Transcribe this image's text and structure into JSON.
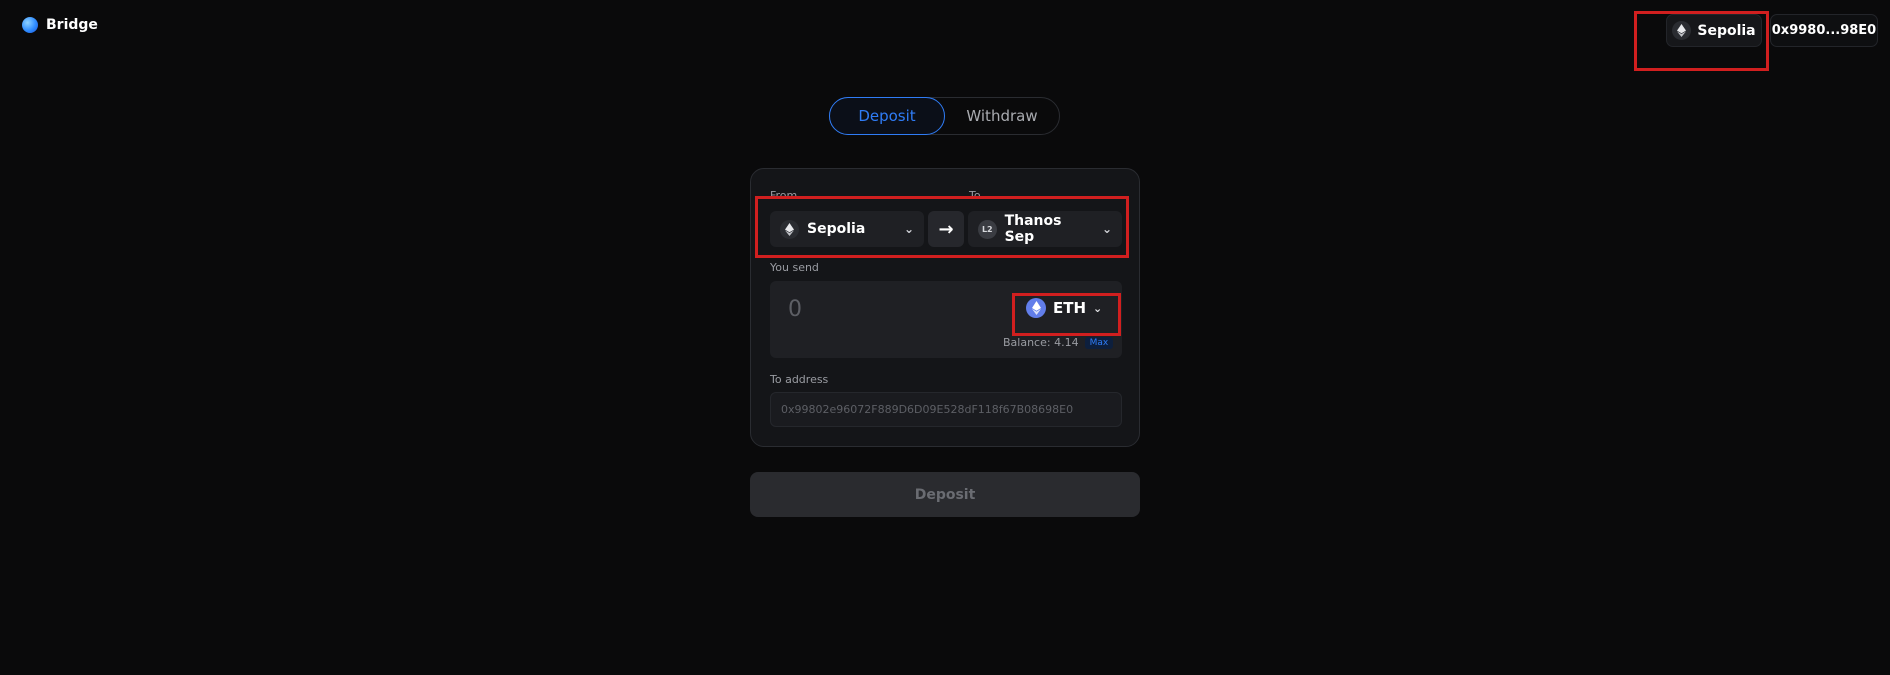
{
  "app": {
    "title": "Bridge"
  },
  "header": {
    "network_label": "Sepolia",
    "network_icon": "ethereum-icon",
    "wallet_label": "0x9980...98E0"
  },
  "tabs": [
    {
      "label": "Deposit",
      "active": true
    },
    {
      "label": "Withdraw",
      "active": false
    }
  ],
  "form": {
    "from_label": "From",
    "to_label": "To",
    "from_network": "Sepolia",
    "to_network": "Thanos Sep",
    "to_network_badge": "L2",
    "you_send_label": "You send",
    "amount_placeholder": "0",
    "token": "ETH",
    "balance_text": "Balance: 4.14",
    "max_label": "Max",
    "to_address_label": "To address",
    "to_address_placeholder": "0x99802e96072F889D6D09E528dF118f67B08698E0"
  },
  "submit": {
    "label": "Deposit"
  },
  "colors": {
    "background": "#0a0a0b",
    "accent": "#2f7cf6",
    "highlight": "#d11f1f"
  }
}
